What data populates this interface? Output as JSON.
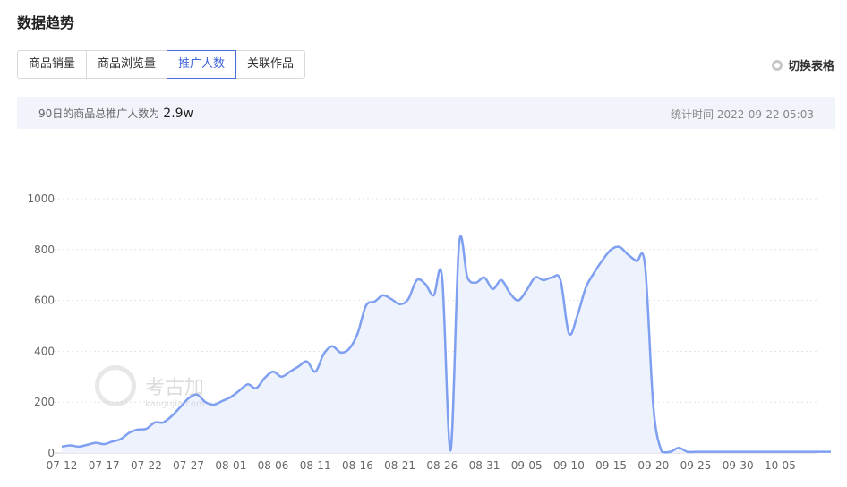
{
  "header": {
    "title": "数据趋势"
  },
  "tabs": [
    {
      "label": "商品销量",
      "active": false
    },
    {
      "label": "商品浏览量",
      "active": false
    },
    {
      "label": "推广人数",
      "active": true
    },
    {
      "label": "关联作品",
      "active": false
    }
  ],
  "toggle": {
    "label": "切换表格"
  },
  "summary": {
    "label": "90日的商品总推广人数为",
    "value": "2.9w",
    "time_label": "统计时间",
    "time_value": "2022-09-22 05:03"
  },
  "watermark": {
    "text": "考古加",
    "sub": "kaogujia.com"
  },
  "colors": {
    "line": "#7f9ff0",
    "area": "#edf2fd",
    "grid": "#e3e3e3",
    "accent": "#3d63d8"
  },
  "chart_data": {
    "type": "area",
    "title": "",
    "xlabel": "",
    "ylabel": "",
    "ylim": [
      0,
      1000
    ],
    "yticks": [
      0,
      200,
      400,
      600,
      800,
      1000
    ],
    "grid": true,
    "xtick_labels": [
      "07-12",
      "07-17",
      "07-22",
      "07-27",
      "08-01",
      "08-06",
      "08-11",
      "08-16",
      "08-21",
      "08-26",
      "08-31",
      "09-05",
      "09-10",
      "09-15",
      "09-20",
      "09-25",
      "09-30",
      "10-05"
    ],
    "series": [
      {
        "values": [
          25,
          30,
          25,
          32,
          40,
          35,
          45,
          55,
          80,
          92,
          95,
          120,
          120,
          145,
          180,
          215,
          230,
          200,
          190,
          205,
          220,
          245,
          270,
          255,
          295,
          320,
          300,
          320,
          340,
          360,
          320,
          390,
          420,
          395,
          410,
          470,
          580,
          595,
          620,
          605,
          585,
          605,
          680,
          665,
          620,
          690,
          10,
          820,
          690,
          670,
          690,
          645,
          680,
          630,
          600,
          640,
          690,
          680,
          690,
          680,
          470,
          540,
          650,
          710,
          760,
          800,
          810,
          780,
          755,
          740,
          180,
          5,
          5,
          20,
          5,
          5,
          5,
          5,
          5,
          5,
          5,
          5,
          5,
          5,
          5,
          5,
          5,
          5,
          5,
          5,
          5,
          5
        ]
      }
    ]
  }
}
